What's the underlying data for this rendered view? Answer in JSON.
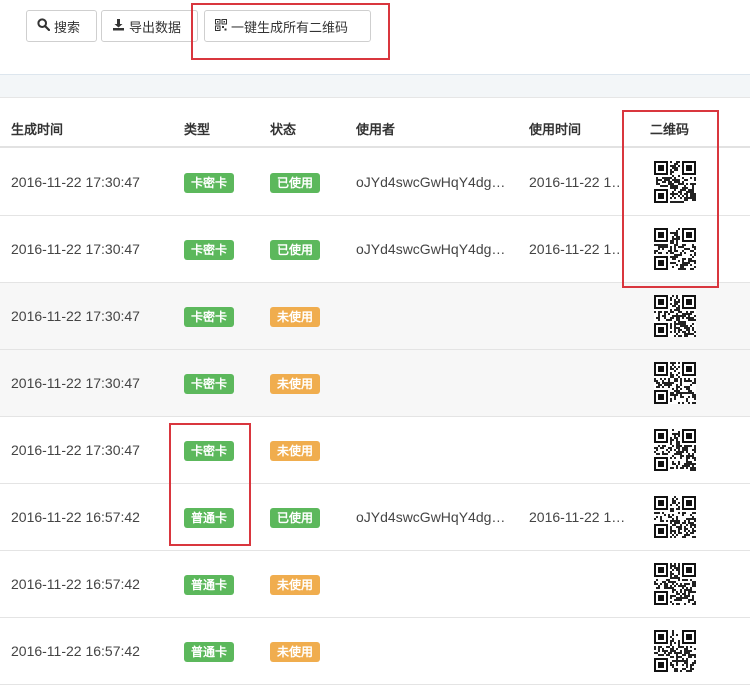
{
  "toolbar": {
    "search_label": "搜索",
    "export_label": "导出数据",
    "generate_qr_label": "一键生成所有二维码"
  },
  "table": {
    "columns": [
      "生成时间",
      "类型",
      "状态",
      "使用者",
      "使用时间",
      "二维码"
    ],
    "rows": [
      {
        "time": "2016-11-22 17:30:47",
        "type": "卡密卡",
        "status": "已使用",
        "status_color": "green",
        "user": "oJYd4swcGwHqY4dg…",
        "used_time": "2016-11-22 1…"
      },
      {
        "time": "2016-11-22 17:30:47",
        "type": "卡密卡",
        "status": "已使用",
        "status_color": "green",
        "user": "oJYd4swcGwHqY4dg…",
        "used_time": "2016-11-22 1…"
      },
      {
        "time": "2016-11-22 17:30:47",
        "type": "卡密卡",
        "status": "未使用",
        "status_color": "orange",
        "user": "",
        "used_time": ""
      },
      {
        "time": "2016-11-22 17:30:47",
        "type": "卡密卡",
        "status": "未使用",
        "status_color": "orange",
        "user": "",
        "used_time": ""
      },
      {
        "time": "2016-11-22 17:30:47",
        "type": "卡密卡",
        "status": "未使用",
        "status_color": "orange",
        "user": "",
        "used_time": ""
      },
      {
        "time": "2016-11-22 16:57:42",
        "type": "普通卡",
        "status": "已使用",
        "status_color": "green",
        "user": "oJYd4swcGwHqY4dg…",
        "used_time": "2016-11-22 1…"
      },
      {
        "time": "2016-11-22 16:57:42",
        "type": "普通卡",
        "status": "未使用",
        "status_color": "orange",
        "user": "",
        "used_time": ""
      },
      {
        "time": "2016-11-22 16:57:42",
        "type": "普通卡",
        "status": "未使用",
        "status_color": "orange",
        "user": "",
        "used_time": ""
      }
    ]
  },
  "colors": {
    "green": "#5cb85c",
    "orange": "#f0ad4e",
    "highlight": "#d9363e"
  },
  "icons": {
    "search": "search-icon",
    "export": "download-icon",
    "qr": "qrcode-icon"
  }
}
